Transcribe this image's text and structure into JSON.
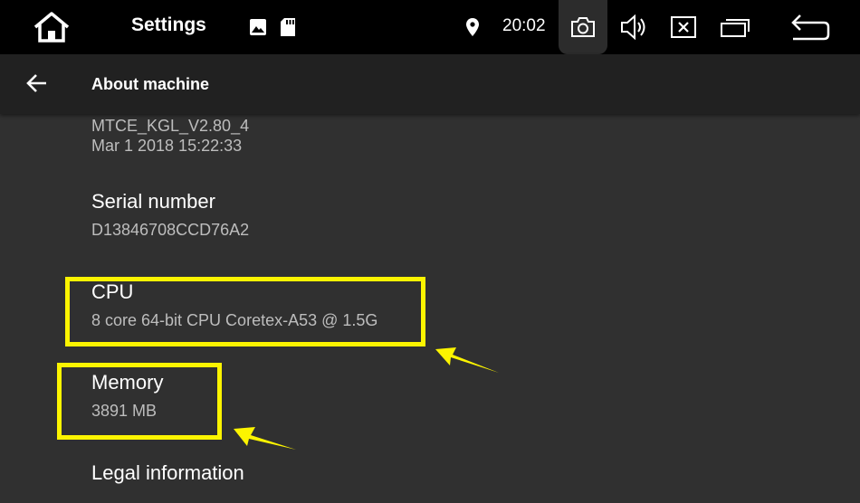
{
  "status_bar": {
    "title": "Settings",
    "time": "20:02",
    "icons": [
      "home-icon",
      "image-icon",
      "sd-card-icon",
      "location-icon",
      "camera-icon",
      "volume-icon",
      "close-box-icon",
      "recent-apps-icon",
      "back-return-icon"
    ]
  },
  "app_bar": {
    "back_icon": "arrow-back-icon",
    "title": "About machine"
  },
  "items": [
    {
      "summary_lines": [
        "MTCE_KGL_V2.80_4",
        "Mar  1 2018 15:22:33"
      ]
    },
    {
      "title": "Serial number",
      "summary": "D13846708CCD76A2"
    },
    {
      "title": "CPU",
      "summary": "8 core 64-bit CPU Coretex-A53 @ 1.5G"
    },
    {
      "title": "Memory",
      "summary": "3891 MB"
    },
    {
      "title": "Legal information"
    }
  ],
  "annotations": {
    "highlight_color": "#fcf400",
    "highlighted_items": [
      "CPU",
      "Memory"
    ]
  }
}
